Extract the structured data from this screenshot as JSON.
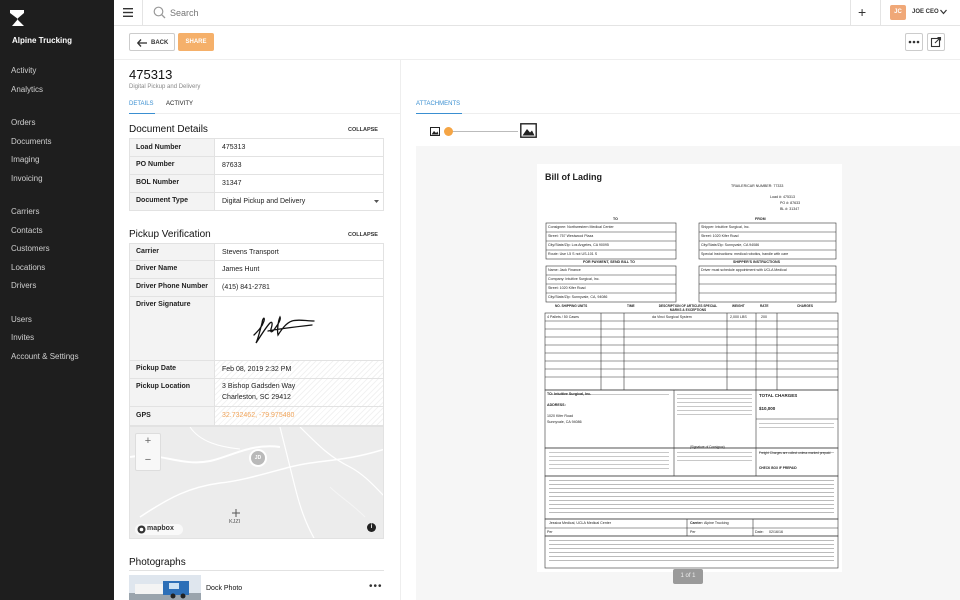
{
  "app": {
    "brand": "Alpine Trucking"
  },
  "sidebar": {
    "items": [
      {
        "label": "Activity"
      },
      {
        "label": "Analytics"
      },
      {
        "label": "Orders"
      },
      {
        "label": "Documents"
      },
      {
        "label": "Imaging"
      },
      {
        "label": "Invoicing"
      },
      {
        "label": "Carriers"
      },
      {
        "label": "Contacts"
      },
      {
        "label": "Customers"
      },
      {
        "label": "Locations"
      },
      {
        "label": "Drivers"
      },
      {
        "label": "Users"
      },
      {
        "label": "Invites"
      },
      {
        "label": "Account & Settings"
      }
    ]
  },
  "topbar": {
    "search_placeholder": "Search",
    "user_initials": "JC",
    "user_name": "JOE CEO"
  },
  "actions": {
    "back": "BACK",
    "share": "SHARE"
  },
  "header": {
    "title": "475313",
    "subtitle": "Digital Pickup and Delivery"
  },
  "tabs": {
    "details": "DETAILS",
    "activity": "ACTIVITY",
    "attachments": "ATTACHMENTS"
  },
  "document_details": {
    "title": "Document Details",
    "collapse": "COLLAPSE",
    "rows": [
      {
        "label": "Load Number",
        "value": "475313"
      },
      {
        "label": "PO Number",
        "value": "87633"
      },
      {
        "label": "BOL Number",
        "value": "31347"
      },
      {
        "label": "Document Type",
        "value": "Digital Pickup and Delivery"
      }
    ]
  },
  "pickup": {
    "title": "Pickup Verification",
    "collapse": "COLLAPSE",
    "carrier_label": "Carrier",
    "carrier": "Stevens Transport",
    "driver_name_label": "Driver Name",
    "driver_name": "James Hunt",
    "driver_phone_label": "Driver Phone Number",
    "driver_phone": "(415) 841-2781",
    "driver_signature_label": "Driver Signature",
    "pickup_date_label": "Pickup Date",
    "pickup_date": "Feb 08, 2019 2:32 PM",
    "pickup_location_label": "Pickup Location",
    "pickup_location_1": "3 Bishop Gadsden Way",
    "pickup_location_2": "Charleston, SC 29412",
    "gps_label": "GPS",
    "gps": "32.732462, -79.975480"
  },
  "map": {
    "marker": "JD",
    "zoom_in": "+",
    "zoom_out": "−",
    "place": "KJZI",
    "attribution": "mapbox"
  },
  "photos": {
    "title": "Photographs",
    "items": [
      {
        "name": "Dock Photo"
      }
    ]
  },
  "viewer": {
    "pager": "1 of 1"
  },
  "bol": {
    "title": "Bill of Lading",
    "trailer": "TRAILER/CAR NUMBER: 77333",
    "load": "Load #: 475313",
    "po": "PO #: 87633",
    "bol": "BL #: 31347",
    "to_label": "TO",
    "from_label": "FROM",
    "consignee": "Consignee: Northwestern Medical Center",
    "street_to": "Street: 757 Westwood Plaza",
    "city_to": "City/State/Zip: Los Angeles, CA 90095",
    "route": "Route: Use I-5 S not US-101 S",
    "shipper": "Shipper: Intuitive Surgical, Inc.",
    "street_from": "Street: 1020 Kifer Road",
    "city_from": "City/State/Zip: Sunnyvale, CA 94086",
    "special": "Special Instructions: medical robotics, handle with care",
    "payment_hdr": "FOR PAYMENT, SEND BILL TO",
    "shipper_instr_hdr": "SHIPPER'S INSTRUCTIONS",
    "pay_name": "Name: Jack Finance",
    "pay_company": "Company: Intuitive Surgical, Inc.",
    "pay_street": "Street: 1020 Kifer Road",
    "pay_city": "City/State/Zip: Sunnyvale, CA, 94086",
    "driver_note": "Driver must schedule appointment with UCLA Medical",
    "col_units": "NO. SHIPPING UNITS",
    "col_time": "TIME",
    "col_desc": "DESCRIPTION OF ARTICLES SPECIAL MARKS & EXCEPTIONS",
    "col_weight": "WEIGHT",
    "col_rate": "RATE",
    "col_charges": "CHARGES",
    "item_units": "4 Pallets / 50 Cases",
    "item_desc": "da Vinci Surgical System",
    "item_weight": "2,000 LBS",
    "item_rate": "200",
    "to_line": "TO: Intuitive Surgical, Inc.",
    "address_label": "ADDRESS:",
    "addr1": "1020 Kifer Road",
    "addr2": "Sunnyvale, CA 94086",
    "consignor_sig": "(Signature of Consignor)",
    "total_charges": "TOTAL CHARGES",
    "total_value": "$10,000",
    "freight_note": "Freight Charges are collect unless marked prepaid",
    "prepaid": "CHECK BOX IF PREPAID",
    "sig_shipper": "Jessica Medical, UCLA Medical Center",
    "sig_carrier_label": "Carrier:",
    "sig_carrier": "Alpine Trucking",
    "sig_date_label": "Date:",
    "sig_date": "02/16/16",
    "per_label": "Per"
  }
}
